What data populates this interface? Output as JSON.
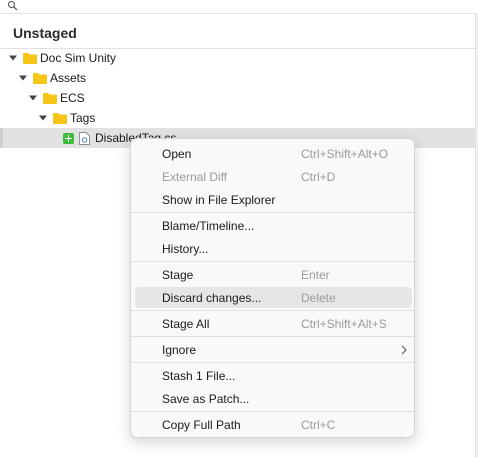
{
  "search": {
    "placeholder": ""
  },
  "section": {
    "title": "Unstaged"
  },
  "tree": [
    {
      "label": "Doc Sim Unity",
      "level": 0
    },
    {
      "label": "Assets",
      "level": 1
    },
    {
      "label": "ECS",
      "level": 2
    },
    {
      "label": "Tags",
      "level": 3
    },
    {
      "label": "DisabledTag.cs",
      "level": 4,
      "status": "added"
    }
  ],
  "context_menu": {
    "items": [
      {
        "label": "Open",
        "shortcut": "Ctrl+Shift+Alt+O",
        "disabled": false
      },
      {
        "label": "External Diff",
        "shortcut": "Ctrl+D",
        "disabled": true
      },
      {
        "label": "Show in File Explorer",
        "shortcut": "",
        "disabled": false
      },
      {
        "label": "Blame/Timeline...",
        "shortcut": "",
        "disabled": false
      },
      {
        "label": "History...",
        "shortcut": "",
        "disabled": false
      },
      {
        "label": "Stage",
        "shortcut": "Enter",
        "disabled": false
      },
      {
        "label": "Discard changes...",
        "shortcut": "Delete",
        "disabled": false,
        "hover": true
      },
      {
        "label": "Stage All",
        "shortcut": "Ctrl+Shift+Alt+S",
        "disabled": false
      },
      {
        "label": "Ignore",
        "shortcut": "",
        "disabled": false,
        "submenu": true
      },
      {
        "label": "Stash 1 File...",
        "shortcut": "",
        "disabled": false
      },
      {
        "label": "Save as Patch...",
        "shortcut": "",
        "disabled": false
      },
      {
        "label": "Copy Full Path",
        "shortcut": "Ctrl+C",
        "disabled": false
      }
    ]
  },
  "colors": {
    "added": "#3dbd3d",
    "folder": "#f5c518",
    "selection": "#e2e2e2"
  }
}
